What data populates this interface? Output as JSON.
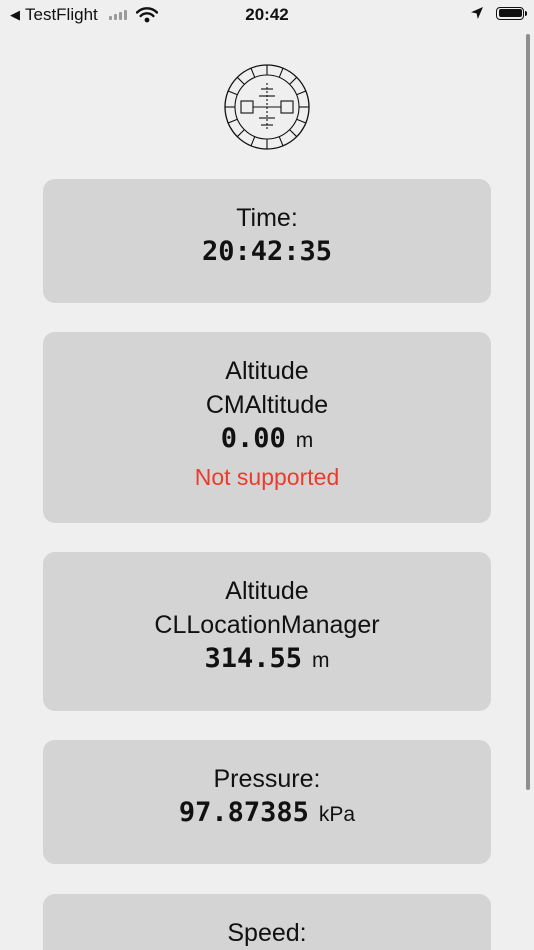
{
  "status_bar": {
    "back_app": "TestFlight",
    "time": "20:42",
    "icons": [
      "back-arrow-icon",
      "signal-bars-icon",
      "wifi-icon",
      "location-arrow-icon",
      "battery-icon"
    ]
  },
  "logo": {
    "icon": "compass-crosshair-logo"
  },
  "cards": {
    "time": {
      "label": "Time:",
      "value": "20:42:35"
    },
    "cm_altitude": {
      "label1": "Altitude",
      "label2": "CMAltitude",
      "value": "0.00",
      "unit": "m",
      "error": "Not supported"
    },
    "cl_altitude": {
      "label1": "Altitude",
      "label2": "CLLocationManager",
      "value": "314.55",
      "unit": "m"
    },
    "pressure": {
      "label": "Pressure:",
      "value": "97.87385",
      "unit": "kPa"
    },
    "speed": {
      "label": "Speed:"
    }
  },
  "colors": {
    "background": "#efefef",
    "card": "#d4d4d4",
    "error": "#ee3a2c"
  }
}
